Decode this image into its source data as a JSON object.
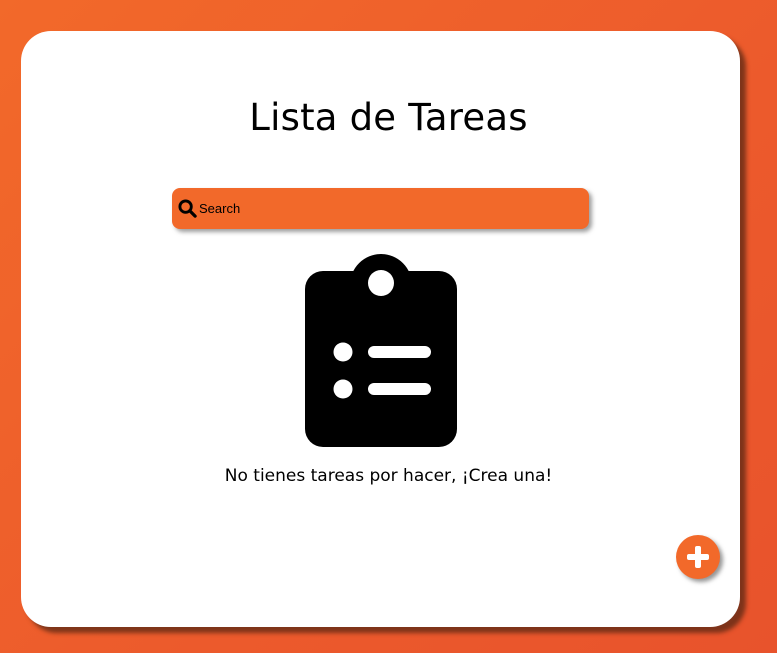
{
  "header": {
    "title": "Lista de Tareas"
  },
  "search": {
    "placeholder": "Search",
    "value": "",
    "icon": "search-icon"
  },
  "empty_state": {
    "icon": "clipboard-list-icon",
    "message": "No tienes tareas por hacer, ¡Crea una!"
  },
  "actions": {
    "add_icon": "plus-icon"
  },
  "colors": {
    "accent": "#f2692a",
    "background": "#ec5a2c",
    "card": "#ffffff",
    "text": "#000000"
  }
}
